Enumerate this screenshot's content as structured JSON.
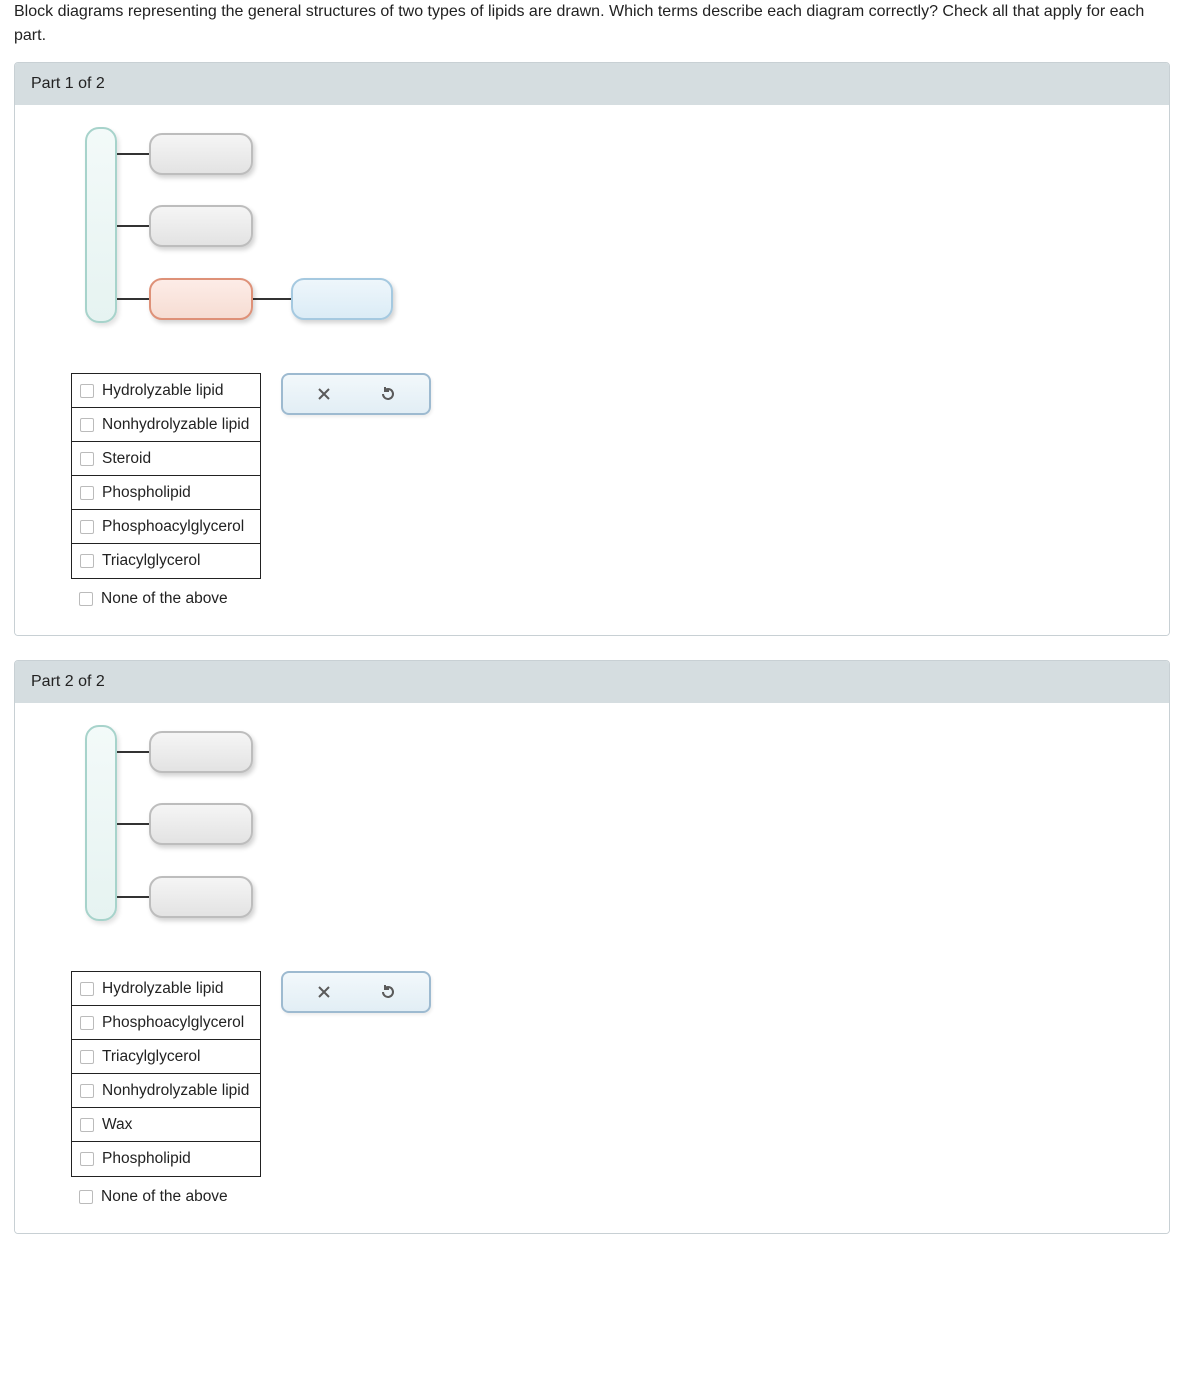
{
  "question": "Block diagrams representing the general structures of two types of lipids are drawn. Which terms describe each diagram correctly? Check all that apply for each part.",
  "parts": [
    {
      "header": "Part 1 of 2",
      "diagram_type": "phospholipid",
      "options": [
        "Hydrolyzable lipid",
        "Nonhydrolyzable lipid",
        "Steroid",
        "Phospholipid",
        "Phosphoacylglycerol",
        "Triacylglycerol"
      ],
      "none_label": "None of the above"
    },
    {
      "header": "Part 2 of 2",
      "diagram_type": "triacylglycerol",
      "options": [
        "Hydrolyzable lipid",
        "Phosphoacylglycerol",
        "Triacylglycerol",
        "Nonhydrolyzable lipid",
        "Wax",
        "Phospholipid"
      ],
      "none_label": "None of the above"
    }
  ]
}
